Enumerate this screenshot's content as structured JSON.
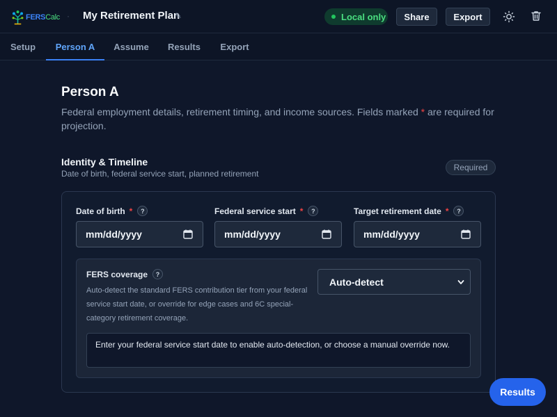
{
  "header": {
    "logo_fers": "FERS",
    "logo_calc": "Calc",
    "separator": "·",
    "plan_title": "My Retirement Plan",
    "status_label": "Local only",
    "share_label": "Share",
    "export_label": "Export",
    "icons": {
      "edit": "pencil-icon",
      "theme": "sun-icon",
      "delete": "trash-icon"
    }
  },
  "tabs": [
    {
      "label": "Setup"
    },
    {
      "label": "Person A",
      "active": true
    },
    {
      "label": "Assume"
    },
    {
      "label": "Results"
    },
    {
      "label": "Export"
    }
  ],
  "page": {
    "title": "Person A",
    "description_before": "Federal employment details, retirement timing, and income sources. Fields marked ",
    "required_mark": "*",
    "description_after": " are required for projection."
  },
  "section": {
    "title": "Identity & Timeline",
    "subtitle": "Date of birth, federal service start, planned retirement",
    "badge": "Required"
  },
  "fields": [
    {
      "label": "Date of birth",
      "required_mark": "*",
      "help": "?",
      "placeholder": "mm/dd/yyyy"
    },
    {
      "label": "Federal service start",
      "required_mark": "*",
      "help": "?",
      "placeholder": "mm/dd/yyyy"
    },
    {
      "label": "Target retirement date",
      "required_mark": "*",
      "help": "?",
      "placeholder": "mm/dd/yyyy"
    }
  ],
  "fers": {
    "title": "FERS coverage",
    "help": "?",
    "description": "Auto-detect the standard FERS contribution tier from your federal service start date, or override for edge cases and 6C special-category retirement coverage.",
    "select_value": "Auto-detect",
    "notice": "Enter your federal service start date to enable auto-detection, or choose a manual override now."
  },
  "fab": {
    "label": "Results"
  },
  "colors": {
    "background": "#0f172a",
    "accent": "#3b82f6",
    "success": "#22c55e",
    "required": "#ef4444"
  }
}
